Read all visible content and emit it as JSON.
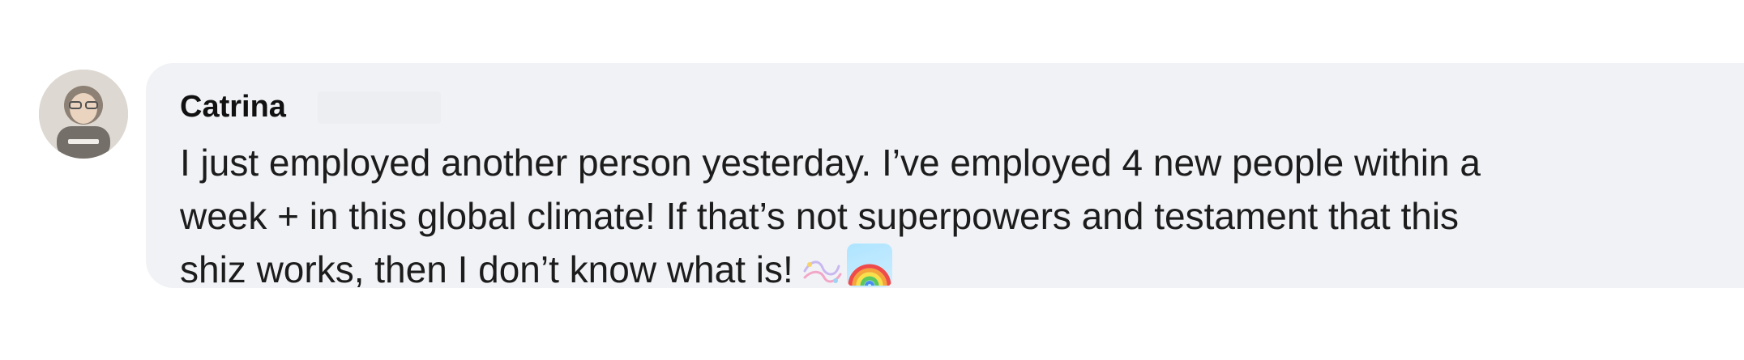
{
  "comment": {
    "author": "Catrina",
    "lines": [
      "I just employed another person yesterday. I’ve employed 4 new people within a",
      "week + in this global climate! If that’s not superpowers and testament that this",
      "shiz works, then I don’t know what is!"
    ],
    "emojis": [
      "sparkles-icon",
      "rainbow-icon"
    ]
  },
  "colors": {
    "bubble_bg": "#f1f2f6",
    "text": "#1c1c1c",
    "author": "#111111"
  }
}
